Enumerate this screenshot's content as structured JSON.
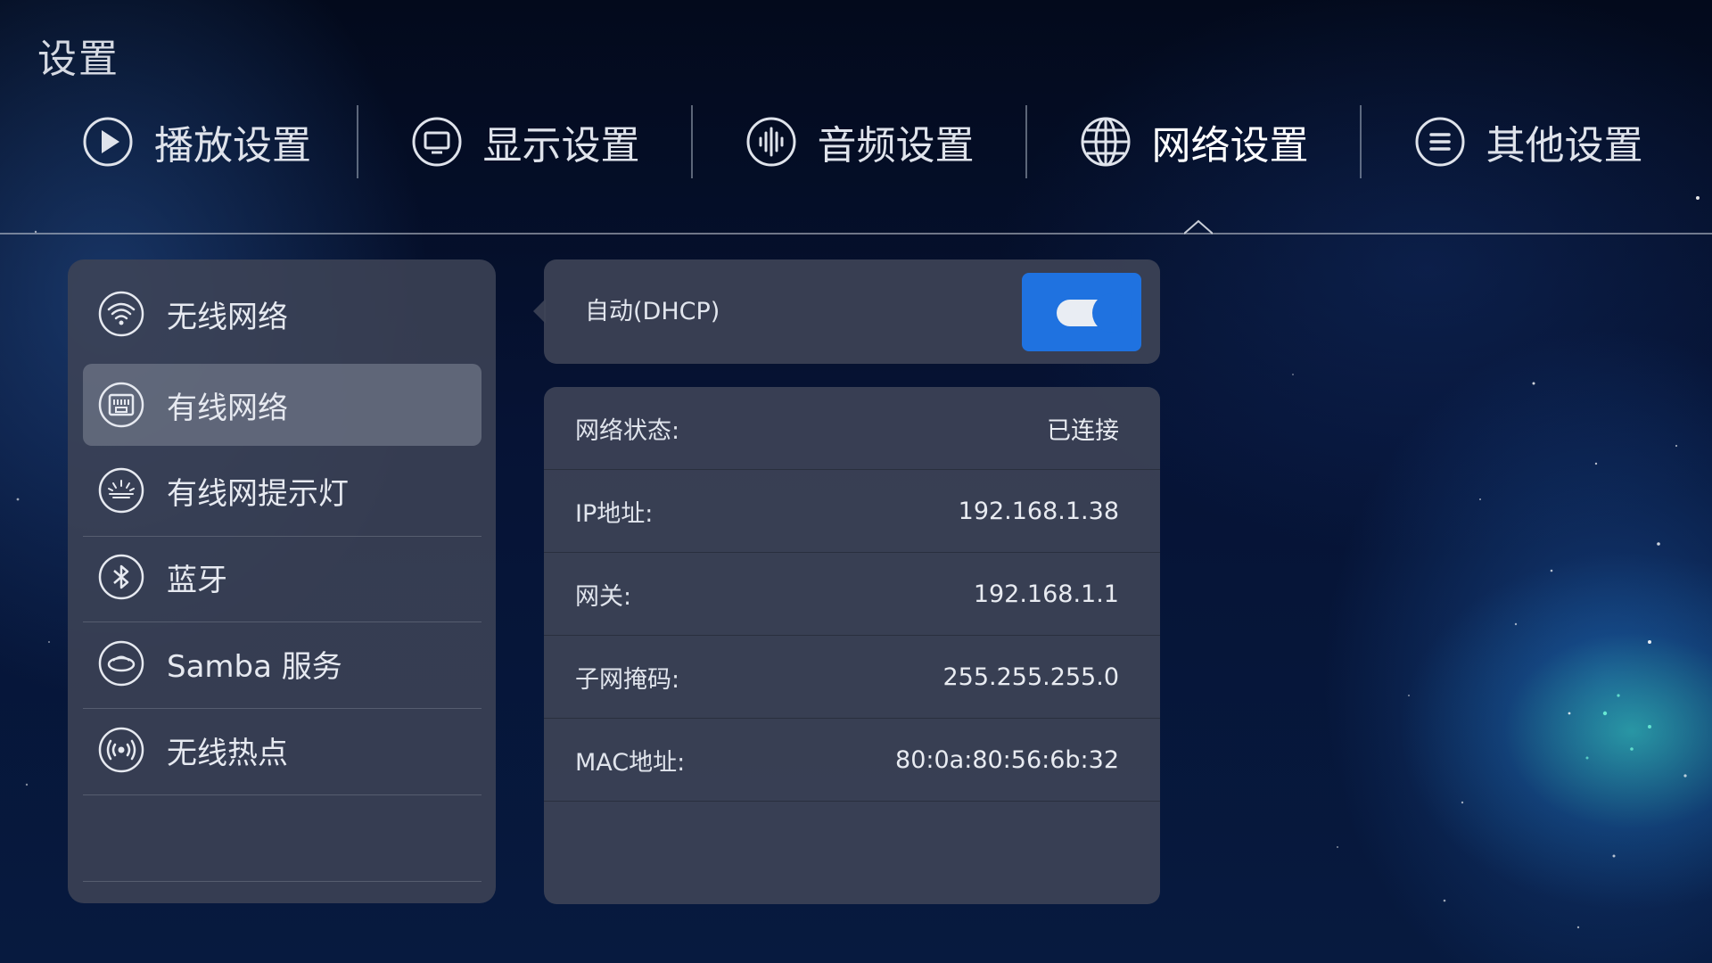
{
  "app": {
    "title": "设置"
  },
  "tabs": [
    {
      "label": "播放设置",
      "icon": "play-circle-icon"
    },
    {
      "label": "显示设置",
      "icon": "monitor-icon"
    },
    {
      "label": "音频设置",
      "icon": "audio-wave-icon"
    },
    {
      "label": "网络设置",
      "icon": "globe-icon",
      "active": true
    },
    {
      "label": "其他设置",
      "icon": "menu-lines-icon"
    }
  ],
  "sidebar": {
    "items": [
      {
        "label": "无线网络",
        "icon": "wifi-icon"
      },
      {
        "label": "有线网络",
        "icon": "ethernet-port-icon",
        "selected": true
      },
      {
        "label": "有线网提示灯",
        "icon": "indicator-light-icon"
      },
      {
        "label": "蓝牙",
        "icon": "bluetooth-icon"
      },
      {
        "label": "Samba 服务",
        "icon": "samba-icon"
      },
      {
        "label": "无线热点",
        "icon": "hotspot-icon"
      }
    ]
  },
  "dhcp": {
    "label": "自动(DHCP)",
    "enabled": true
  },
  "network_info": {
    "rows": [
      {
        "label": "网络状态:",
        "value": "已连接"
      },
      {
        "label": "IP地址:",
        "value": "192.168.1.38"
      },
      {
        "label": "网关:",
        "value": "192.168.1.1"
      },
      {
        "label": "子网掩码:",
        "value": "255.255.255.0"
      },
      {
        "label": "MAC地址:",
        "value": "80:0a:80:56:6b:32"
      }
    ]
  },
  "colors": {
    "accent": "#1f72e0",
    "panel": "#3e4456",
    "selected_item": "#6e7486"
  }
}
